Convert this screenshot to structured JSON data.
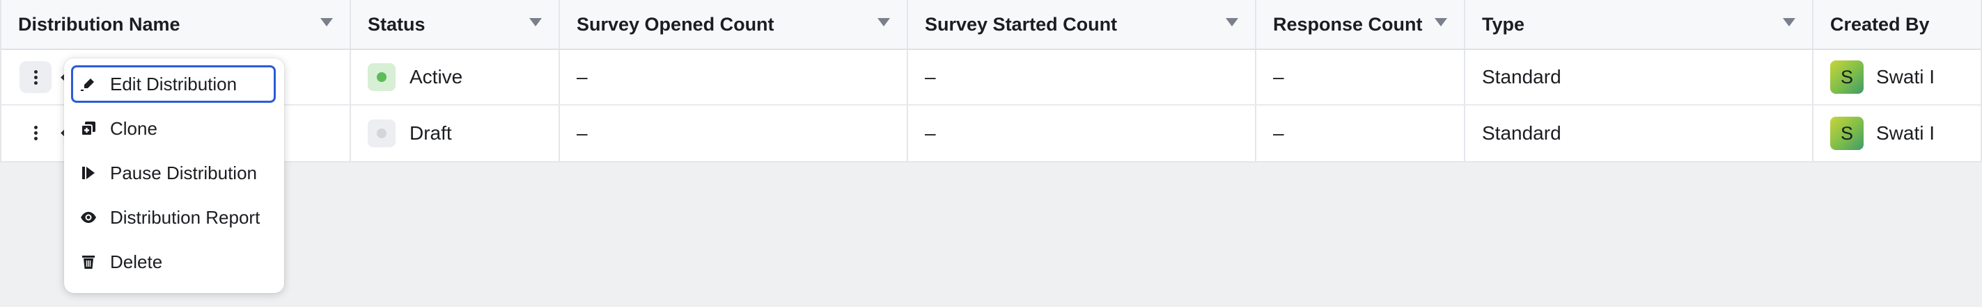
{
  "table": {
    "columns": [
      {
        "label": "Distribution Name"
      },
      {
        "label": "Status"
      },
      {
        "label": "Survey Opened Count"
      },
      {
        "label": "Survey Started Count"
      },
      {
        "label": "Response Count"
      },
      {
        "label": "Type"
      },
      {
        "label": "Created By"
      }
    ],
    "rows": [
      {
        "status": "Active",
        "status_color": "#5dbb5a",
        "survey_opened": "–",
        "survey_started": "–",
        "response_count": "–",
        "type": "Standard",
        "avatar_initial": "S",
        "created_by": "Swati I"
      },
      {
        "status": "Draft",
        "status_color": "#d3d5da",
        "survey_opened": "–",
        "survey_started": "–",
        "response_count": "–",
        "type": "Standard",
        "avatar_initial": "S",
        "created_by": "Swati I"
      }
    ]
  },
  "context_menu": {
    "items": [
      {
        "label": "Edit Distribution",
        "icon": "edit-icon"
      },
      {
        "label": "Clone",
        "icon": "clone-icon"
      },
      {
        "label": "Pause Distribution",
        "icon": "pause-icon"
      },
      {
        "label": "Distribution Report",
        "icon": "eye-icon"
      },
      {
        "label": "Delete",
        "icon": "trash-icon"
      }
    ]
  },
  "colors": {
    "focus_ring": "#2a5bd7",
    "page_background": "#eff0f2"
  }
}
